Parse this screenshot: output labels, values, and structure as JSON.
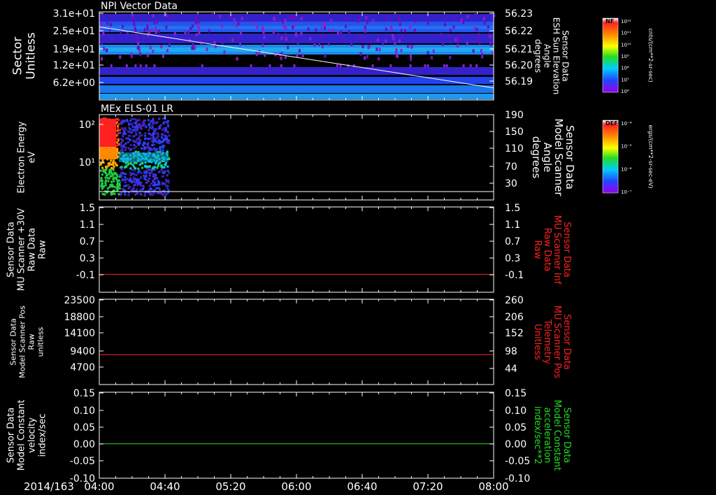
{
  "chart_data": [
    {
      "type": "heatmap",
      "title": "NPI Vector Data",
      "ylabel": [
        "Sector",
        "Unitless"
      ],
      "ylabel_right": [
        "Sensor Data",
        "ESH Sun Elevation",
        "Angle",
        "degrees"
      ],
      "yticks": [
        "3.1e+01",
        "2.5e+01",
        "1.9e+01",
        "1.2e+01",
        "6.2e+00"
      ],
      "yticks_right": [
        "56.23",
        "56.22",
        "56.21",
        "56.20",
        "56.19"
      ],
      "overlay_line": {
        "color": "#ffffff",
        "x": [
          "04:00",
          "08:00"
        ],
        "y": [
          56.222,
          56.186
        ]
      },
      "colorbar": {
        "label": "NF",
        "units": "cnts/(cm**2-sr-sec)",
        "ticks": [
          "10¹²",
          "10¹¹",
          "10¹⁰",
          "10⁹",
          "10⁸",
          "10⁷",
          "10⁶"
        ]
      }
    },
    {
      "type": "heatmap",
      "title": "MEx ELS-01 LR",
      "ylabel": [
        "Electron Energy",
        "eV"
      ],
      "ylabel_right": [
        "Sensor Data",
        "Model Scanner",
        "Angle",
        "degrees"
      ],
      "yticks": [
        "10²",
        "10¹"
      ],
      "yticks_right": [
        "190",
        "150",
        "110",
        "70",
        "30"
      ],
      "data_interval": [
        "04:00",
        "04:42"
      ],
      "colorbar": {
        "label": "DEF",
        "units": "ergs/(cm**2-sr-sec-eV)",
        "ticks": [
          "10⁻⁴",
          "10⁻⁵",
          "10⁻⁶",
          "10⁻⁷"
        ]
      }
    },
    {
      "type": "line",
      "ylabel": [
        "Sensor Data",
        "MU Scanner +30V",
        "Raw Data",
        "Raw"
      ],
      "ylabel_right": [
        "Sensor Data",
        "MU Scanner Inf",
        "Raw Data",
        "Raw"
      ],
      "yticks": [
        "1.5",
        "1.1",
        "0.7",
        "0.3",
        "-0.1"
      ],
      "yticks_right": [
        "1.5",
        "1.1",
        "0.7",
        "0.3",
        "-0.1"
      ],
      "ylim": [
        -0.4,
        1.5
      ],
      "series": [
        {
          "color": "#ff2020",
          "x": [
            "04:00",
            "08:00"
          ],
          "y": [
            0.0,
            0.0
          ]
        }
      ]
    },
    {
      "type": "line",
      "ylabel": [
        "Sensor Data",
        "Model Scanner Pos",
        "Raw",
        "unitless"
      ],
      "ylabel_right": [
        "Sensor Data",
        "MU Scanner Pos",
        "Telemetry",
        "Unitless"
      ],
      "yticks": [
        "23500",
        "18800",
        "14100",
        "9400",
        "4700"
      ],
      "yticks_right": [
        "260",
        "206",
        "152",
        "98",
        "44"
      ],
      "ylim": [
        0,
        23500
      ],
      "series": [
        {
          "color": "#ff2020",
          "x": [
            "04:00",
            "08:00"
          ],
          "y": [
            8200,
            8200
          ]
        }
      ]
    },
    {
      "type": "line",
      "ylabel": [
        "Sensor Data",
        "Model Constant",
        "velocity",
        "index/sec"
      ],
      "ylabel_right": [
        "Sensor Data",
        "Model Constant",
        "acceleration",
        "index/sec**2"
      ],
      "yticks": [
        "0.15",
        "0.10",
        "0.05",
        "0.00",
        "-0.05",
        "-0.10"
      ],
      "yticks_right": [
        "0.15",
        "0.10",
        "0.05",
        "0.00",
        "-0.05",
        "-0.10"
      ],
      "ylim": [
        -0.1,
        0.15
      ],
      "series": [
        {
          "color": "#22dd22",
          "x": [
            "04:00",
            "08:00"
          ],
          "y": [
            0.0,
            0.0
          ]
        }
      ]
    }
  ],
  "time_axis": {
    "date": "2014/163",
    "ticks": [
      "04:00",
      "04:40",
      "05:20",
      "06:00",
      "06:40",
      "07:20",
      "08:00"
    ]
  },
  "colors": {
    "right_label_panel3": "#ff2020",
    "right_label_panel4": "#ff2020",
    "right_label_panel5": "#22dd22"
  }
}
